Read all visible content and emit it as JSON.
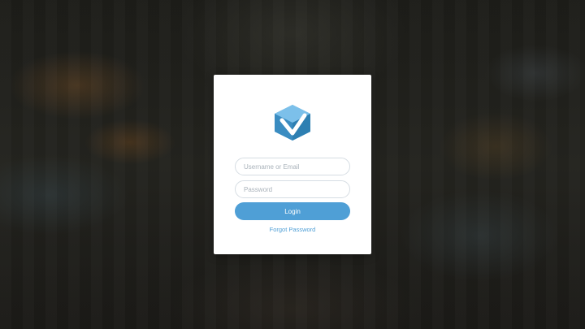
{
  "login_form": {
    "username_placeholder": "Username or Email",
    "password_placeholder": "Password",
    "login_label": "Login",
    "forgot_label": "Forgot Password"
  },
  "colors": {
    "accent": "#4f9fd6",
    "logo_dark": "#2d7fb2",
    "logo_light": "#5aaee0",
    "card_background": "#ffffff"
  },
  "icons": {
    "logo": "hexagon-check-logo-icon"
  }
}
